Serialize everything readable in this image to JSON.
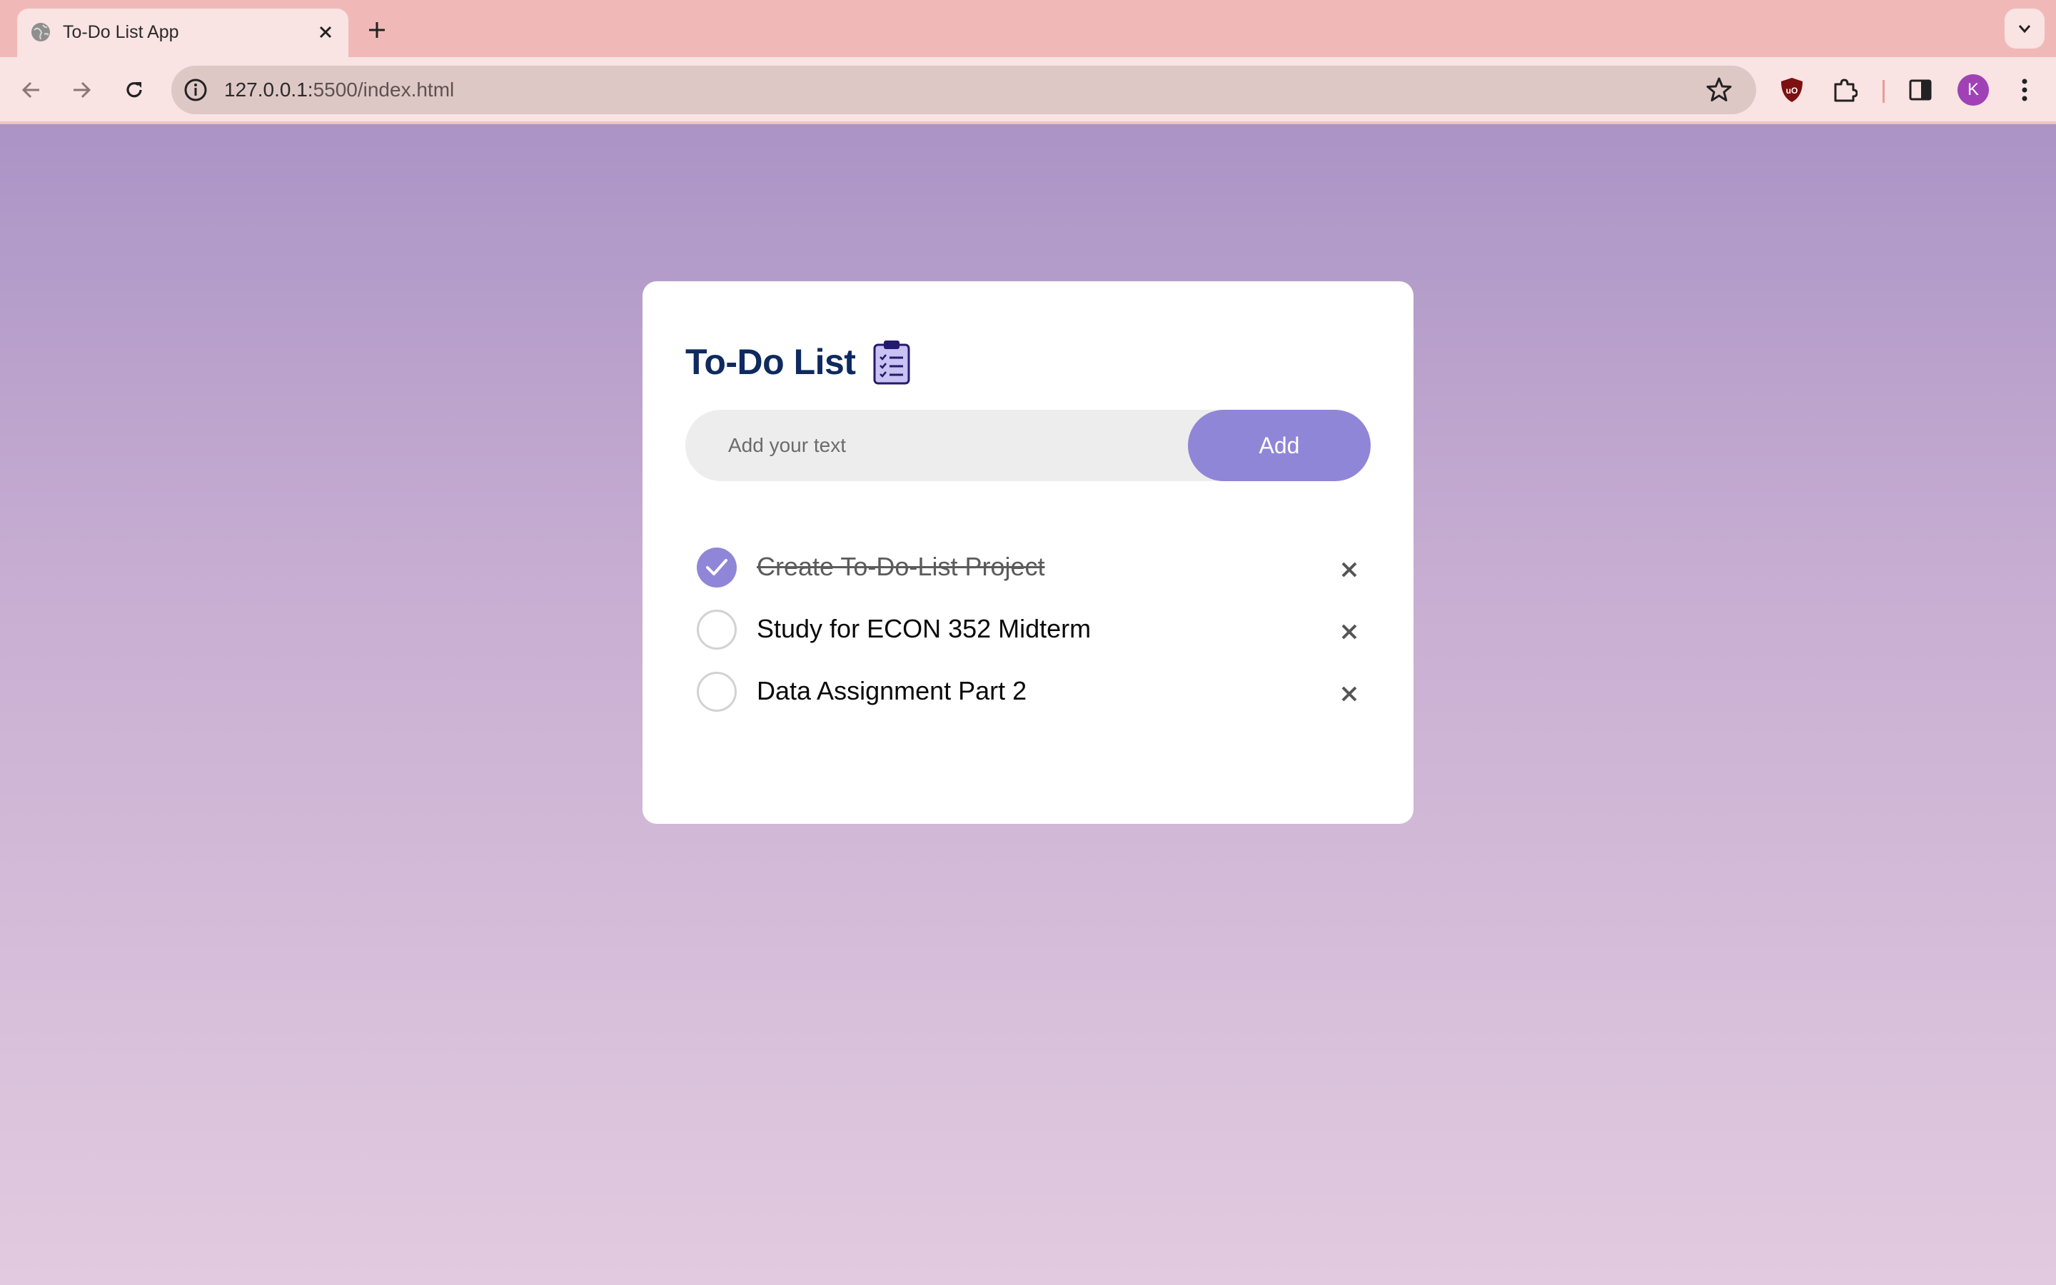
{
  "browser": {
    "tab": {
      "title": "To-Do List App",
      "favicon": "globe-icon",
      "close_icon": "close-icon"
    },
    "new_tab_icon": "plus-icon",
    "tab_search_icon": "chevron-down-icon",
    "nav": {
      "back_icon": "arrow-left-icon",
      "forward_icon": "arrow-right-icon",
      "reload_icon": "reload-icon"
    },
    "address_bar": {
      "info_icon": "info-icon",
      "host": "127.0.0.1:",
      "path": "5500/index.html",
      "bookmark_icon": "star-icon"
    },
    "extensions": [
      "ublock-shield-icon",
      "puzzle-icon",
      "sidebar-icon"
    ],
    "profile": {
      "initial": "K",
      "color": "#a042b5"
    },
    "menu_icon": "more-vert-icon"
  },
  "app": {
    "title": "To-Do List",
    "title_icon": "clipboard-checklist-icon",
    "input": {
      "placeholder": "Add your text",
      "value": ""
    },
    "add_button": "Add",
    "accent_color": "#8f86d8",
    "tasks": [
      {
        "label": "Create To-Do-List Project",
        "done": true
      },
      {
        "label": "Study for ECON 352 Midterm",
        "done": false
      },
      {
        "label": "Data Assignment Part 2",
        "done": false
      }
    ]
  }
}
